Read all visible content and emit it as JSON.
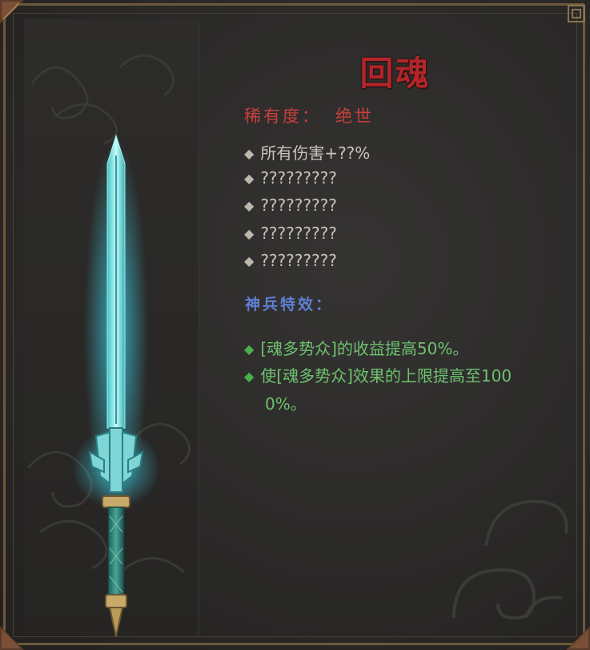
{
  "item": {
    "name": "回魂",
    "rarity_label": "稀有度：",
    "rarity_value": "绝世"
  },
  "stats": [
    "所有伤害+??%",
    "?????????",
    "?????????",
    "?????????",
    "?????????"
  ],
  "effects": {
    "heading": "神兵特效：",
    "items": [
      {
        "line1": "[魂多势众]的收益提高50%。",
        "line2": ""
      },
      {
        "line1": "使[魂多势众]效果的上限提高至100",
        "line2": "0%。"
      }
    ]
  },
  "bullet_glyph": "◆",
  "colors": {
    "title": "#b0262a",
    "rarity": "#c8403c",
    "stat_text": "#c9c4bc",
    "effect_heading": "#5f7fd4",
    "effect_text": "#6ec16e",
    "frame": "#6e5a3a"
  },
  "icons": {
    "weapon": "glowing-jade-sword-icon"
  }
}
